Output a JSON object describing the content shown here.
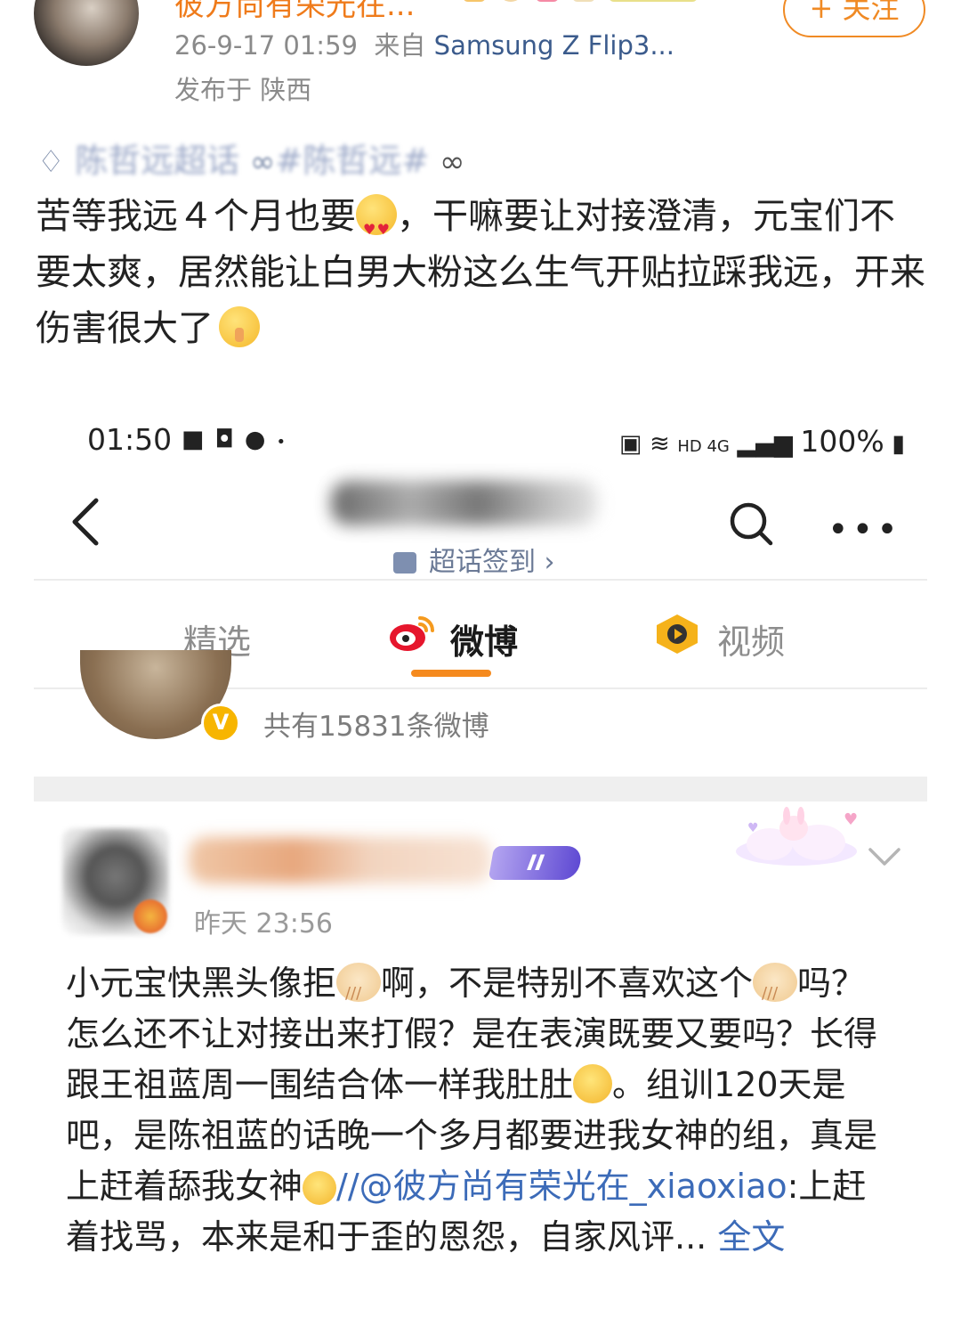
{
  "outer_post": {
    "username": "彼方尚有荣光在...",
    "follow_label": "+ 关注",
    "timestamp": "26-9-17 01:59",
    "source_prefix": "来自",
    "device": "Samsung Z Flip3...",
    "location": "发布于 陕西",
    "topic_blurred": "陈哲远超话",
    "topic_hashtag": "#陈哲远#",
    "text_part1": "苦等我远４个月也要",
    "text_part2": "，干嘛要让对接澄清，元宝们不要太爽，居然能让白男大粉这么生气开贴拉踩我远，开来伤害很大了"
  },
  "embedded_status": {
    "time": "01:50",
    "battery": "100%",
    "network": "HD 4G"
  },
  "embedded_nav": {
    "title_blurred": "陈哲远超话",
    "checkin_label": "超话签到",
    "tabs": [
      "精选",
      "微博",
      "视频"
    ],
    "active_tab": "微博",
    "post_count": "共有15831条微博"
  },
  "embedded_post": {
    "username_blurred": "用户名",
    "level_badge": "II",
    "time": "昨天 23:56",
    "seg1": "小元宝快黑头像拒",
    "seg2": "啊，不是特别不喜欢这个",
    "seg3": "吗？怎么还不让对接出来打假？是在表演既要又要吗？长得跟王祖蓝周一围结合体一样我肚肚",
    "seg4": "。组训120天是吧，是陈祖蓝的话晚一个多月都要进我女神的组，真是上赶着舔我女神",
    "mention": "//@彼方尚有荣光在_xiaoxiao",
    "seg5": ":上赶着找骂，本来是和于歪的恩怨，自家风评...",
    "full_text_label": "全文"
  },
  "colors": {
    "accent_orange": "#f08a24",
    "link_blue": "#3c6bb8",
    "tab_indicator": "#f58a1e"
  }
}
